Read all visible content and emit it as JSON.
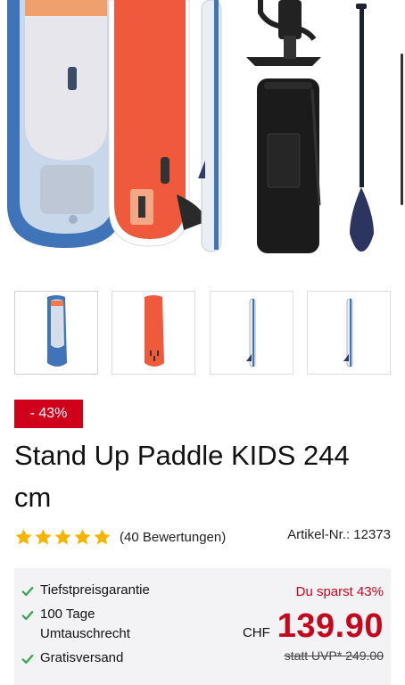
{
  "product": {
    "discount_badge": "- 43%",
    "title": "Stand Up Paddle KIDS 244 cm",
    "reviews": "(40 Bewertungen)",
    "rating": 5,
    "rating_max": 5,
    "article_no": "Artikel-Nr.: 12373"
  },
  "gallery": {
    "thumbnails": [
      "board-top-view",
      "board-bottom-view",
      "board-side-view",
      "board-side-view-2"
    ]
  },
  "benefits": {
    "items": [
      "Tiefstpreisgarantie",
      "100 Tage Umtauschrecht",
      "Gratisversand"
    ]
  },
  "pricing": {
    "savings": "Du sparst 43%",
    "currency": "CHF",
    "price": "139.90",
    "uvp": "statt UVP* 249.00"
  },
  "colors": {
    "accent_red": "#d0021b",
    "check_green": "#3aa655",
    "star_gold": "#f5b400",
    "board_blue": "#3f74b8",
    "board_orange": "#ef5a3c"
  }
}
